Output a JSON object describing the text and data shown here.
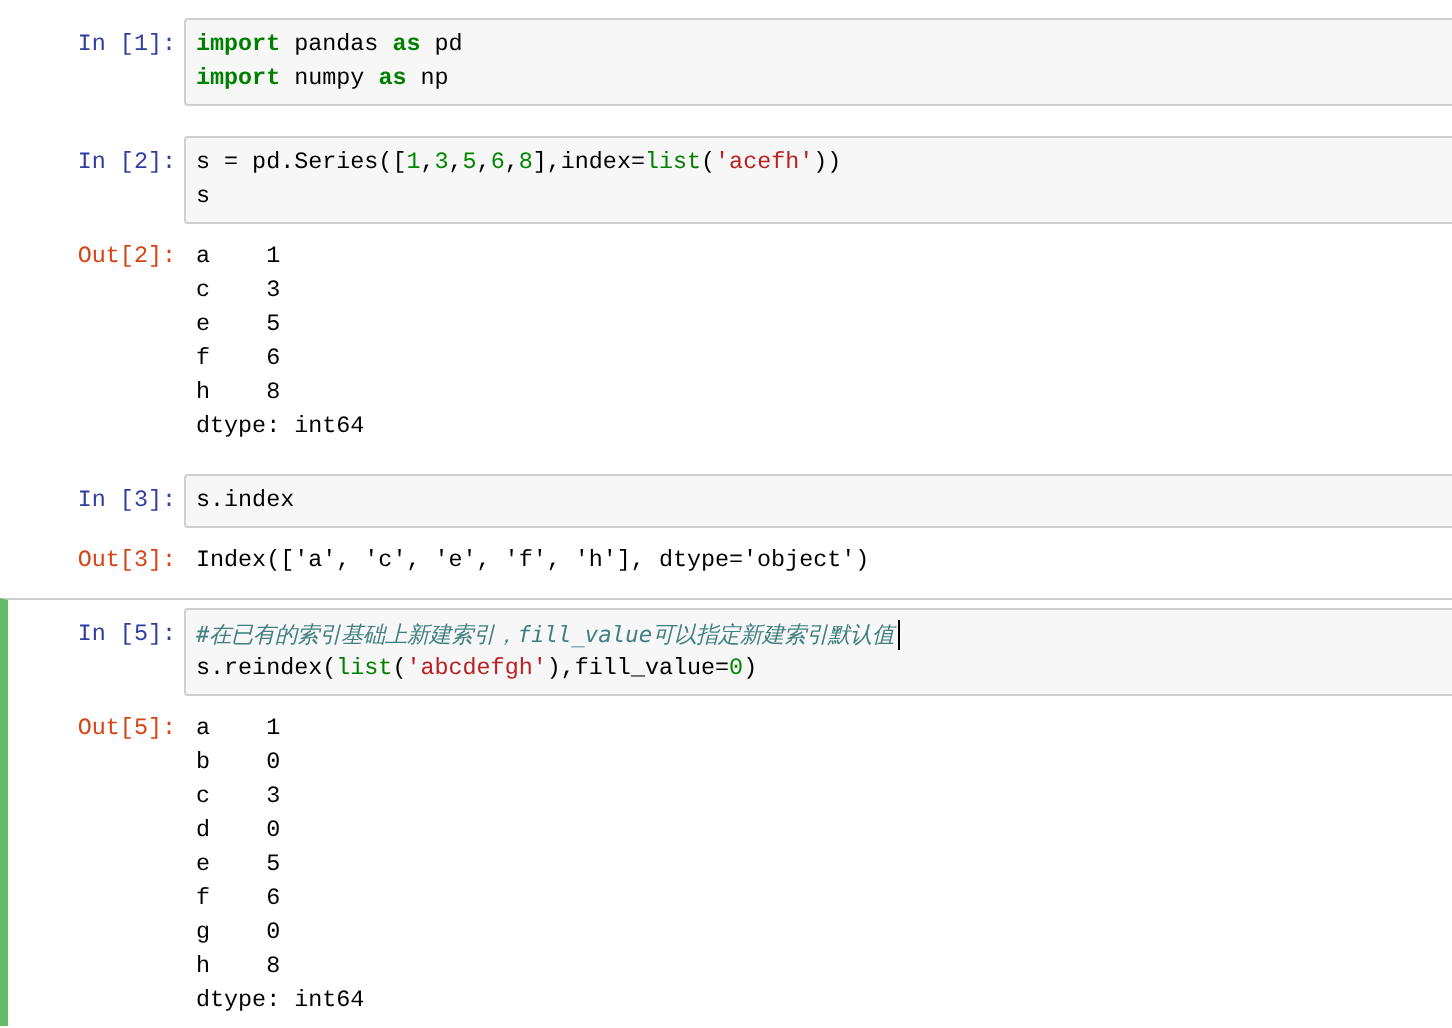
{
  "cells": [
    {
      "prompt": "In [1]:",
      "selected": false,
      "code": [
        {
          "cursor": false,
          "tokens": [
            {
              "kind": "keyword",
              "text": "import"
            },
            {
              "kind": "plain",
              "text": " pandas "
            },
            {
              "kind": "keyword",
              "text": "as"
            },
            {
              "kind": "plain",
              "text": " pd"
            }
          ]
        },
        {
          "cursor": false,
          "tokens": [
            {
              "kind": "keyword",
              "text": "import"
            },
            {
              "kind": "plain",
              "text": " numpy "
            },
            {
              "kind": "keyword",
              "text": "as"
            },
            {
              "kind": "plain",
              "text": " np"
            }
          ]
        }
      ]
    },
    {
      "prompt": "In [2]:",
      "selected": false,
      "code": [
        {
          "cursor": false,
          "tokens": [
            {
              "kind": "plain",
              "text": "s = pd.Series(["
            },
            {
              "kind": "number",
              "text": "1"
            },
            {
              "kind": "plain",
              "text": ","
            },
            {
              "kind": "number",
              "text": "3"
            },
            {
              "kind": "plain",
              "text": ","
            },
            {
              "kind": "number",
              "text": "5"
            },
            {
              "kind": "plain",
              "text": ","
            },
            {
              "kind": "number",
              "text": "6"
            },
            {
              "kind": "plain",
              "text": ","
            },
            {
              "kind": "number",
              "text": "8"
            },
            {
              "kind": "plain",
              "text": "],index="
            },
            {
              "kind": "builtin",
              "text": "list"
            },
            {
              "kind": "plain",
              "text": "("
            },
            {
              "kind": "string",
              "text": "'acefh'"
            },
            {
              "kind": "plain",
              "text": "))"
            }
          ]
        },
        {
          "cursor": false,
          "tokens": [
            {
              "kind": "plain",
              "text": "s"
            }
          ]
        }
      ],
      "output": {
        "prompt": "Out[2]:",
        "lines": [
          "a    1",
          "c    3",
          "e    5",
          "f    6",
          "h    8",
          "dtype: int64"
        ]
      }
    },
    {
      "prompt": "In [3]:",
      "selected": false,
      "code": [
        {
          "cursor": false,
          "tokens": [
            {
              "kind": "plain",
              "text": "s.index"
            }
          ]
        }
      ],
      "output": {
        "prompt": "Out[3]:",
        "lines": [
          "Index(['a', 'c', 'e', 'f', 'h'], dtype='object')"
        ]
      }
    },
    {
      "prompt": "In [5]:",
      "selected": true,
      "code": [
        {
          "cursor": true,
          "tokens": [
            {
              "kind": "comment",
              "text": "#在已有的索引基础上新建索引，fill_value可以指定新建索引默认值"
            }
          ]
        },
        {
          "cursor": false,
          "tokens": [
            {
              "kind": "plain",
              "text": "s.reindex("
            },
            {
              "kind": "builtin",
              "text": "list"
            },
            {
              "kind": "plain",
              "text": "("
            },
            {
              "kind": "string",
              "text": "'abcdefgh'"
            },
            {
              "kind": "plain",
              "text": "),fill_value="
            },
            {
              "kind": "number",
              "text": "0"
            },
            {
              "kind": "plain",
              "text": ")"
            }
          ]
        }
      ],
      "output": {
        "prompt": "Out[5]:",
        "lines": [
          "a    1",
          "b    0",
          "c    3",
          "d    0",
          "e    5",
          "f    6",
          "g    0",
          "h    8",
          "dtype: int64"
        ]
      }
    }
  ]
}
